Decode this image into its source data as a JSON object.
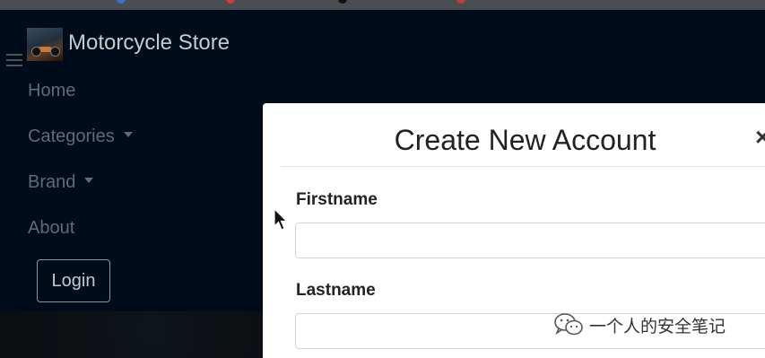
{
  "navbar": {
    "brand": "Motorcycle Store",
    "items": [
      {
        "label": "Home"
      },
      {
        "label": "Categories"
      },
      {
        "label": "Brand"
      },
      {
        "label": "About"
      }
    ],
    "login_label": "Login"
  },
  "modal": {
    "title": "Create New Account",
    "close_symbol": "×",
    "fields": [
      {
        "label": "Firstname",
        "value": "",
        "placeholder": ""
      },
      {
        "label": "Lastname",
        "value": "",
        "placeholder": ""
      }
    ]
  },
  "watermark": {
    "text": "一个人的安全笔记",
    "icon": "wechat-icon"
  },
  "colors": {
    "navbar_bg": "#000c1a",
    "nav_link": "#5f6b78",
    "modal_bg": "#ffffff"
  }
}
